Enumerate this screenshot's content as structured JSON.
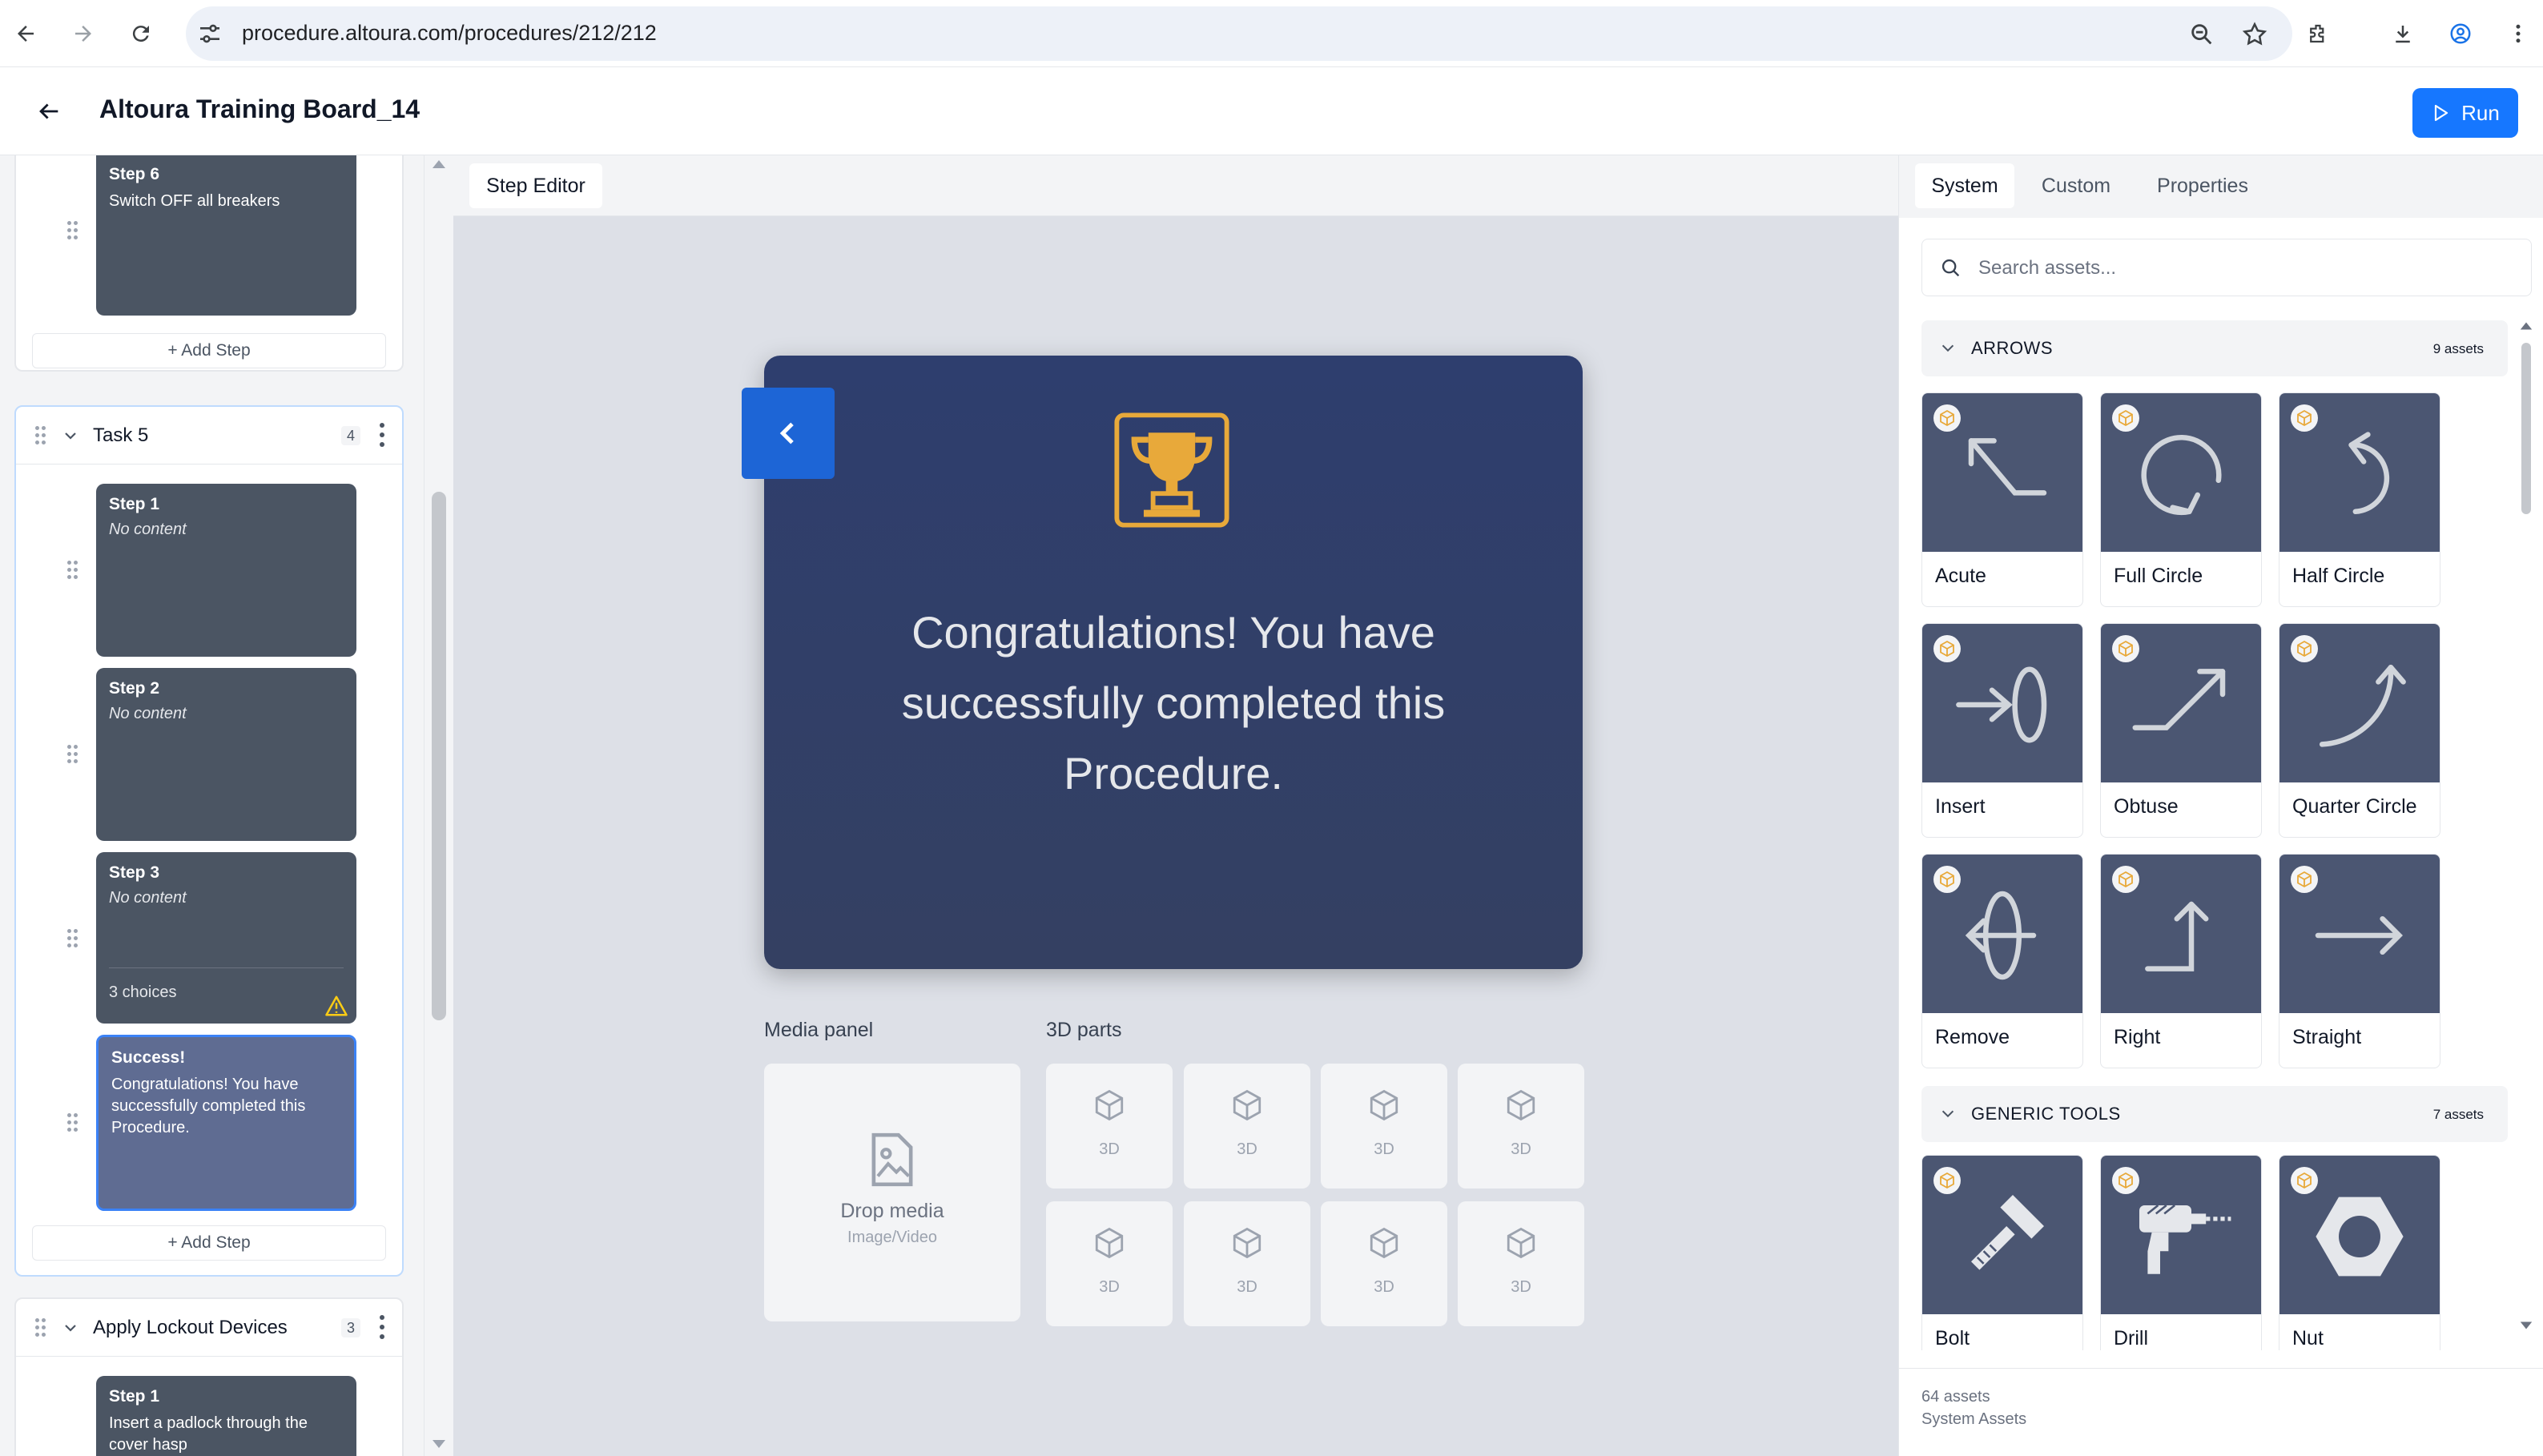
{
  "browser": {
    "url": "procedure.altoura.com/procedures/212/212"
  },
  "header": {
    "title": "Altoura Training Board_14",
    "run_label": "Run"
  },
  "sidebar": {
    "task4_tail": {
      "step6": {
        "title": "Step 6",
        "desc": "Switch OFF all breakers"
      },
      "add_step": "+ Add Step"
    },
    "task5": {
      "title": "Task 5",
      "count": "4",
      "steps": [
        {
          "title": "Step 1",
          "desc": "No content"
        },
        {
          "title": "Step 2",
          "desc": "No content"
        },
        {
          "title": "Step 3",
          "desc": "No content",
          "choices": "3 choices"
        },
        {
          "title": "Success!",
          "desc": "Congratulations! You have successfully completed this Procedure."
        }
      ],
      "add_step": "+ Add Step"
    },
    "task6": {
      "title": "Apply Lockout Devices",
      "count": "3",
      "steps": [
        {
          "title": "Step 1",
          "desc": "Insert a padlock through the cover hasp"
        }
      ]
    }
  },
  "editor": {
    "tab_label": "Step Editor",
    "card_message": "Congratulations! You have successfully completed this Procedure.",
    "media_panel_label": "Media panel",
    "parts_label": "3D parts",
    "drop_media": "Drop media",
    "drop_sub": "Image/Video",
    "part_slot_label": "3D",
    "colors": {
      "card_bg": "#2e3e6e",
      "trophy": "#e8a93a",
      "accent": "#1677ff"
    }
  },
  "assets": {
    "tabs": [
      "System",
      "Custom",
      "Properties"
    ],
    "active_tab": "System",
    "search_placeholder": "Search assets...",
    "categories": [
      {
        "name": "ARROWS",
        "count": "9 assets",
        "items": [
          "Acute",
          "Full Circle",
          "Half Circle",
          "Insert",
          "Obtuse",
          "Quarter Circle",
          "Remove",
          "Right",
          "Straight"
        ]
      },
      {
        "name": "GENERIC TOOLS",
        "count": "7 assets",
        "items": [
          "Bolt",
          "Drill",
          "Nut"
        ]
      }
    ],
    "footer_count": "64 assets",
    "footer_source": "System Assets"
  }
}
